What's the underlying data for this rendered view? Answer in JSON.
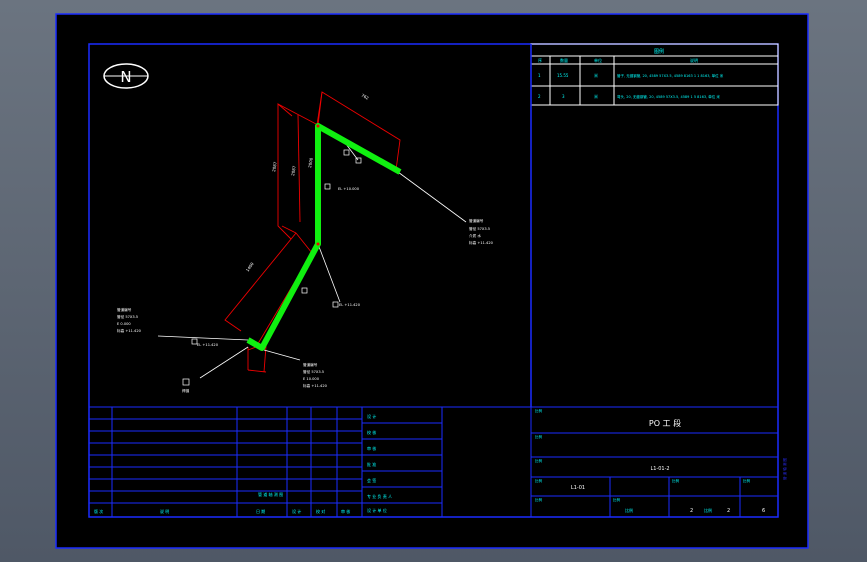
{
  "compass": {
    "label": "N"
  },
  "legend_table": {
    "header": "图例",
    "columns": [
      "序",
      "数量",
      "单位",
      "说明"
    ],
    "rows": [
      {
        "no": "1",
        "qty": "15.55",
        "unit": "米",
        "desc": "管子, 无缝钢管, 20, 4589 57X3.5, 4589 8163 1 1 8163, 单位 米"
      },
      {
        "no": "2",
        "qty": "3",
        "unit": "米",
        "desc": "弯头, 20, 无缝钢管, 20, 4589 57X3.5, 4589 1 5 8163, 单位 米"
      }
    ]
  },
  "annotations": {
    "main_v1": "2087",
    "main_v2": "2087",
    "top_dim": "762",
    "mid_label": "2000",
    "lower_dim": "1400",
    "right_leader": [
      "管道编号",
      "管径 57X3.5",
      "介质 水",
      "标高 +11.420"
    ],
    "left_leader": [
      "管道编号",
      "管径 57X3.5",
      "E 0.000",
      "标高 +11.420"
    ],
    "bottom_leader": [
      "管道编号",
      "管径 57X3.5",
      "E 10.000",
      "标高 +11.420"
    ],
    "elev_top": "EL +10.000",
    "elev_mid": "EL +11.420",
    "elev_left": "EL +11.420",
    "node_label": "焊缝"
  },
  "title_block": {
    "project": "PO 工 段",
    "drawing_no": "L1-01-2",
    "sheet_code": "L1-01",
    "scale_label": "比例",
    "sheet": "2",
    "of": "2",
    "rev": "6",
    "bottom_strip": "管 道 轴 测 图",
    "left_cells": [
      "版 次",
      "说 明",
      "日 期",
      "设 计",
      "校 对",
      "审 核"
    ],
    "mid_cells": [
      "设 计",
      "校 核",
      "审 核",
      "批 准",
      "会 签",
      "专 业 负 责 人"
    ],
    "company": "设 计 单 位"
  }
}
